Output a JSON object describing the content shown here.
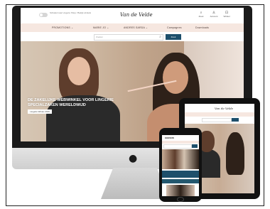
{
  "site": {
    "switch_text": "Schakel naar Lingerie Shop / Bekijk winkels",
    "logo": "Van de Velde",
    "header_icons": [
      {
        "icon": "search-icon",
        "glyph": "⌕",
        "label": "Zoek"
      },
      {
        "icon": "user-icon",
        "glyph": "♙",
        "label": "Account"
      },
      {
        "icon": "cart-icon",
        "glyph": "⊡",
        "label": "Winkel"
      }
    ],
    "nav": [
      "PROMOTIONS ⌄",
      "MARIE JO ⌄",
      "ANDRES SARDA ⌄",
      "Campagnes",
      "Downloads"
    ],
    "search_placeholder": "Zoeken",
    "search_button": "Zoek",
    "hero_title": "DE ZAKELIJKE WEBWINKEL VOOR LINGERIE SPECIALZAKEN WERELDWIJD",
    "hero_button": "Lingerie Winter 2019"
  },
  "tablet": {
    "logo": "Van de Velde"
  },
  "phone": {
    "logo": "GEESON"
  },
  "colors": {
    "accent": "#1e4f6b",
    "nav_bg": "#f6e7e0"
  },
  "device_icons": {
    "brand": "apple-logo"
  }
}
